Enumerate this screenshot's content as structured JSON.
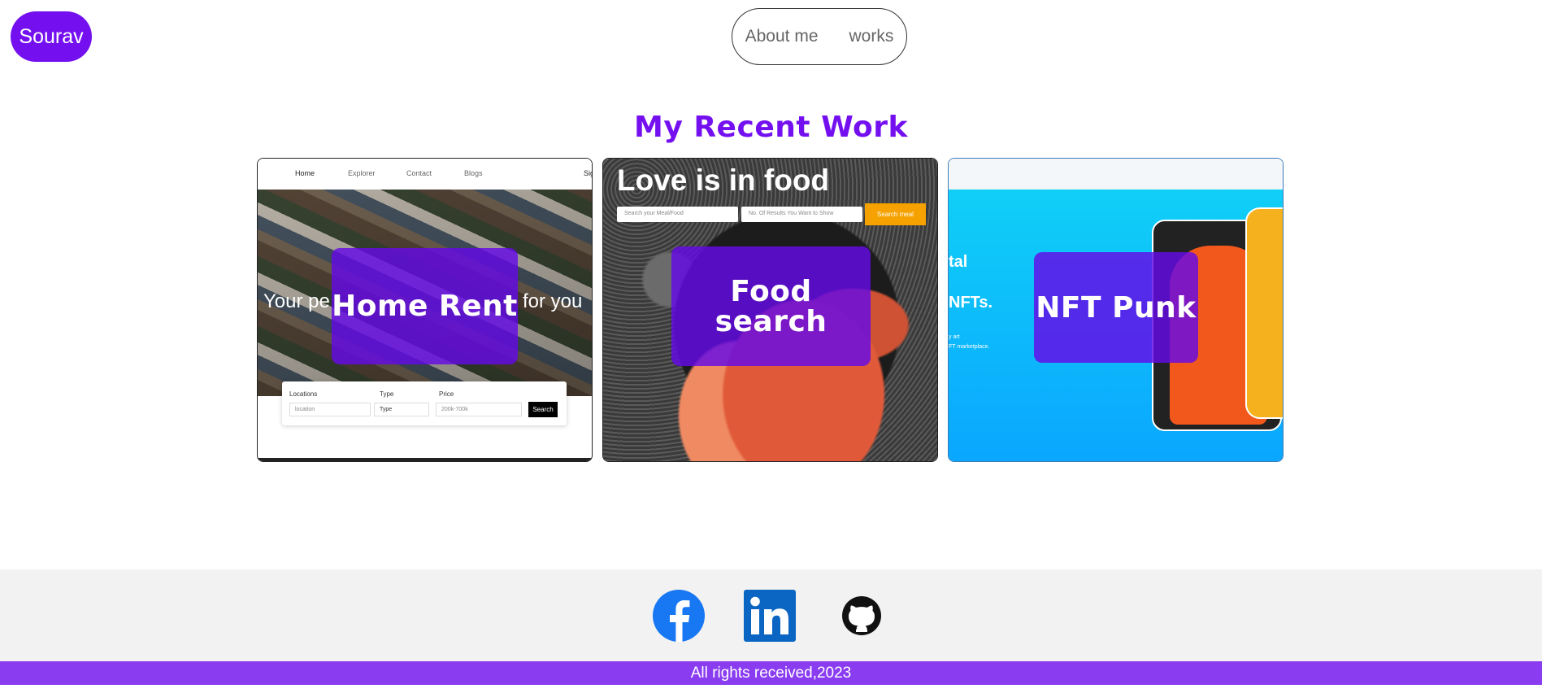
{
  "header": {
    "logo_text": "Sourav",
    "nav": [
      {
        "label": "About me"
      },
      {
        "label": "works"
      }
    ]
  },
  "section": {
    "title": "My Recent Work"
  },
  "cards": [
    {
      "overlay_title": "Home Rent",
      "preview": {
        "nav_items": [
          "Home",
          "Explorer",
          "Contact",
          "Blogs",
          "Sig"
        ],
        "hero_text_left": "Your pe",
        "hero_text_right": "for you",
        "search_labels": [
          "Locations",
          "Type",
          "Price"
        ],
        "location_placeholder": "location",
        "type_value": "Type",
        "price_value": "200k-700k",
        "search_button": "Search"
      }
    },
    {
      "overlay_title": "Food search",
      "preview": {
        "headline": "Love is in food",
        "meal_placeholder": "Search your Meal/Food",
        "count_placeholder": "No. Of Results You Want to Show",
        "search_button": "Search meal"
      }
    },
    {
      "overlay_title": "NFT Punk",
      "preview": {
        "line1": "tal",
        "line2": "NFTs.",
        "line3a": "y art",
        "line3b": "FT marketplace."
      }
    }
  ],
  "footer": {
    "social": [
      {
        "name": "facebook",
        "color": "#1877f2"
      },
      {
        "name": "linkedin",
        "color": "#0a66c2"
      },
      {
        "name": "github",
        "color": "#111111"
      }
    ],
    "copyright": "All rights received,2023"
  },
  "colors": {
    "accent": "#7410f0",
    "footer_bar": "#8a3cf0"
  }
}
